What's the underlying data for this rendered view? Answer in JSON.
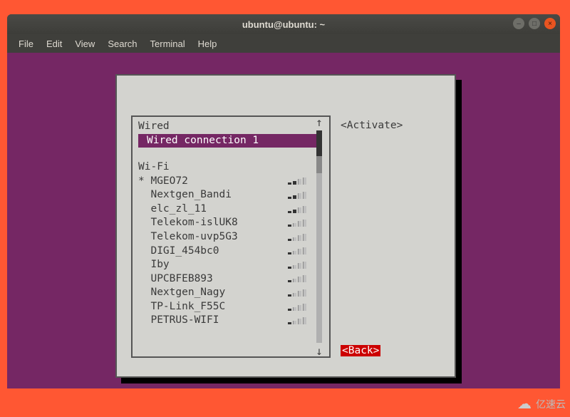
{
  "window": {
    "title": "ubuntu@ubuntu: ~"
  },
  "menubar": {
    "items": [
      "File",
      "Edit",
      "View",
      "Search",
      "Terminal",
      "Help"
    ]
  },
  "tui": {
    "wired_header": "Wired",
    "wired_selected": "Wired connection 1",
    "wifi_header": "Wi-Fi",
    "wifi_items": [
      {
        "prefix": "* ",
        "name": "MGEO72",
        "bars": 2
      },
      {
        "prefix": "  ",
        "name": "Nextgen_Bandi",
        "bars": 2
      },
      {
        "prefix": "  ",
        "name": "elc_zl_11",
        "bars": 2
      },
      {
        "prefix": "  ",
        "name": "Telekom-islUK8",
        "bars": 1
      },
      {
        "prefix": "  ",
        "name": "Telekom-uvp5G3",
        "bars": 1
      },
      {
        "prefix": "  ",
        "name": "DIGI_454bc0",
        "bars": 1
      },
      {
        "prefix": "  ",
        "name": "Iby",
        "bars": 1
      },
      {
        "prefix": "  ",
        "name": "UPCBFEB893",
        "bars": 1
      },
      {
        "prefix": "  ",
        "name": "Nextgen_Nagy",
        "bars": 1
      },
      {
        "prefix": "  ",
        "name": "TP-Link_F55C",
        "bars": 1
      },
      {
        "prefix": "  ",
        "name": "PETRUS-WIFI",
        "bars": 1
      }
    ],
    "btn_activate": "<Activate>",
    "btn_back": "<Back>"
  },
  "watermark": "亿速云"
}
